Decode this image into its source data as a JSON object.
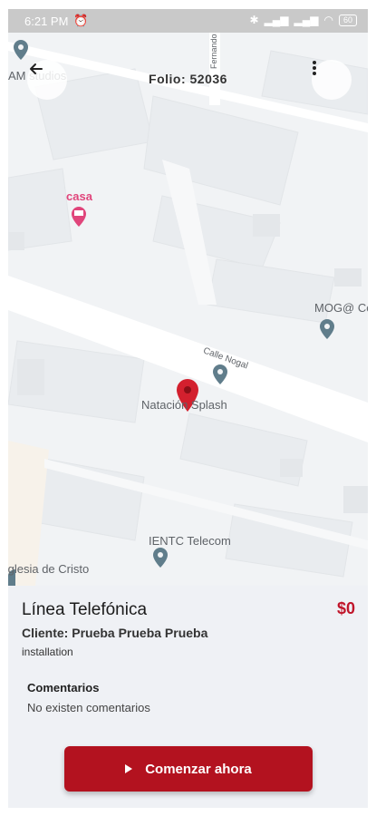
{
  "status_bar": {
    "time": "6:21 PM",
    "battery": "60"
  },
  "header": {
    "folio": "Folio: 52036"
  },
  "map": {
    "labels": {
      "studios": "AM studios",
      "casa": "casa",
      "mog": "MOG@ Co",
      "calle": "Calle Nogal",
      "natacion": "Natación Splash",
      "ientc": "IENTC Telecom",
      "iglesia": "Iglesia de Cristo",
      "street_top": "Fernando"
    },
    "colors": {
      "pin": "#d3202e",
      "casa": "#e0457b",
      "poi": "#607d8b"
    }
  },
  "details": {
    "service": "Línea Telefónica",
    "price": "$0",
    "client": "Cliente: Prueba Prueba Prueba",
    "type": "installation",
    "comments_label": "Comentarios",
    "comments_value": "No existen comentarios",
    "start_button": "Comenzar ahora"
  }
}
